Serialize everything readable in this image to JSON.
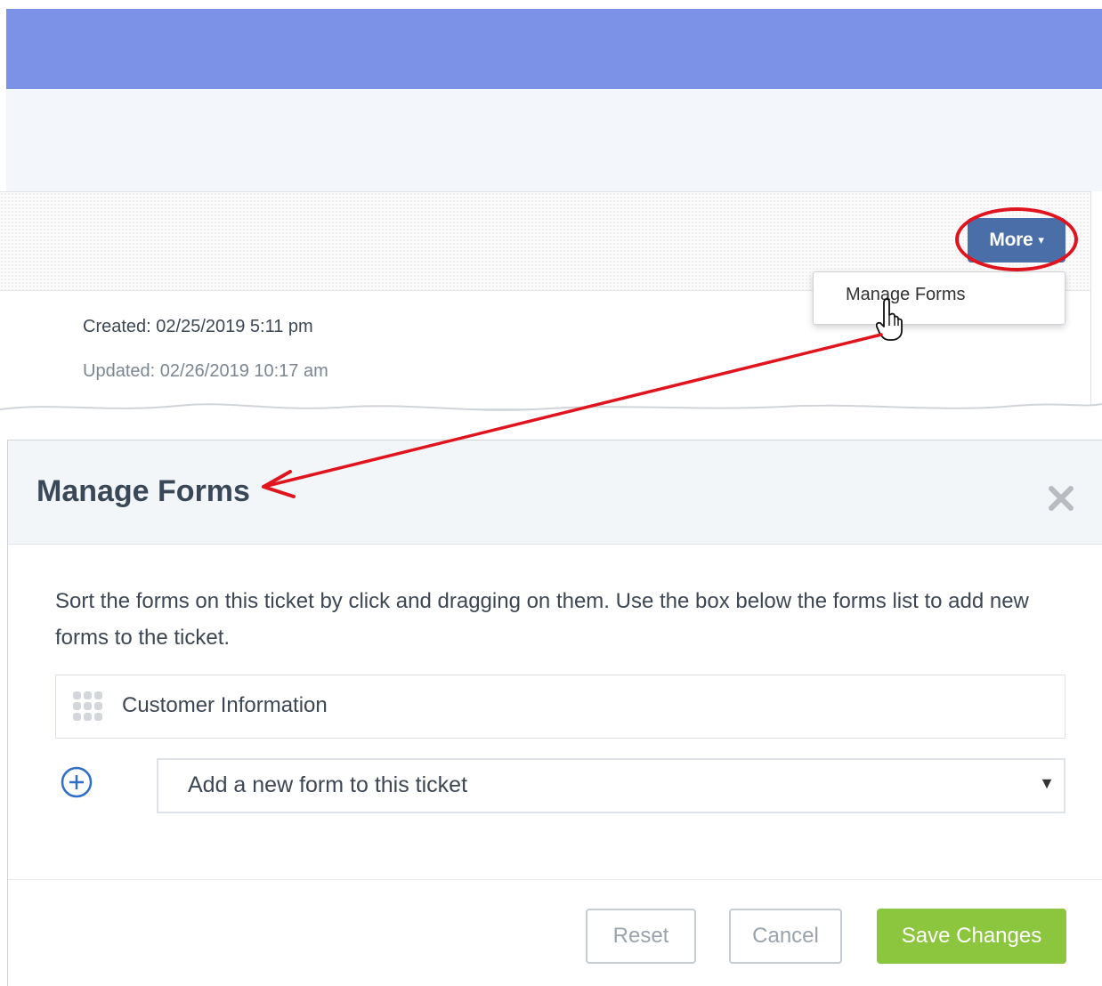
{
  "header": {
    "more_button": {
      "label": "More",
      "caret": "▾"
    },
    "dropdown": {
      "items": [
        {
          "label": "Manage Forms"
        }
      ]
    }
  },
  "ticket": {
    "created": "Created: 02/25/2019 5:11 pm",
    "updated": "Updated: 02/26/2019 10:17 am"
  },
  "modal": {
    "title": "Manage Forms",
    "description": "Sort the forms on this ticket by click and dragging on them. Use the box below the forms list to add new forms to the ticket.",
    "forms": [
      {
        "label": "Customer Information",
        "icon": "drag-handle-icon"
      }
    ],
    "add_select": {
      "value": "Add a new form to this ticket",
      "icon": "add-circle-icon"
    },
    "buttons": {
      "reset": "Reset",
      "cancel": "Cancel",
      "save": "Save Changes"
    }
  },
  "colors": {
    "top_bar": "#7b92e6",
    "more_button": "#4a6fa8",
    "annotation": "#e0141e",
    "save_button": "#8cc63f"
  }
}
